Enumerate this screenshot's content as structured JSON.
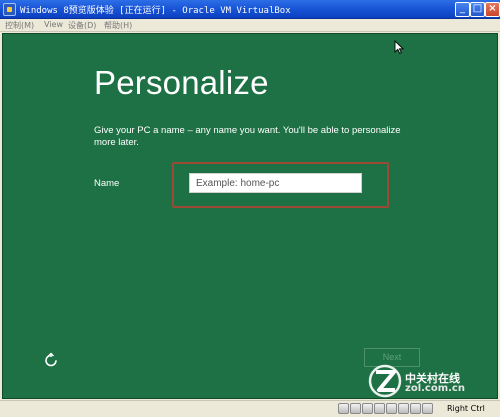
{
  "window": {
    "title": "Windows 8预览版体验 [正在运行] - Oracle VM VirtualBox",
    "minimize_label": "_",
    "maximize_label": "□",
    "close_label": "×"
  },
  "menubar": {
    "items": [
      {
        "label": "控制(M)"
      },
      {
        "label": "View"
      },
      {
        "label": "设备(D)"
      },
      {
        "label": "帮助(H)"
      }
    ]
  },
  "setup": {
    "heading": "Personalize",
    "description": "Give your PC a name – any name you want. You'll be able to personalize more later.",
    "name_label": "Name",
    "name_input": {
      "value": "",
      "placeholder": "Example: home-pc"
    },
    "next_label": "Next",
    "background_color": "#1e7145",
    "highlight_color": "#9b4a35"
  },
  "watermark": {
    "chinese": "中关村在线",
    "domain": "zol.com.cn"
  },
  "statusbar": {
    "host_key": "Right Ctrl",
    "icons": [
      "hard-disk-icon",
      "optical-drive-icon",
      "usb-icon",
      "network-icon",
      "shared-folder-icon",
      "display-icon",
      "recording-icon",
      "mouse-integration-icon"
    ]
  }
}
